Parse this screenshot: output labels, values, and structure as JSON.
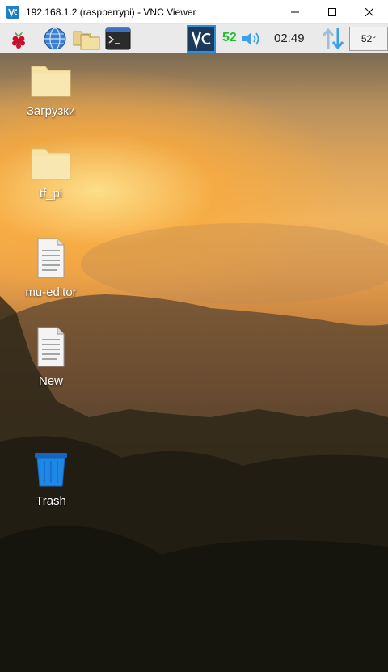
{
  "window": {
    "title": "192.168.1.2 (raspberrypi) - VNC Viewer",
    "app_icon": "vnc-viewer-icon"
  },
  "taskbar": {
    "launchers": [
      "raspberry-menu-icon",
      "web-browser-icon",
      "file-manager-icon",
      "terminal-icon"
    ],
    "cpu_usage": "52",
    "clock": "02:49",
    "temperature": "52°"
  },
  "desktop": {
    "icons": [
      {
        "label": "Загрузки",
        "icon": "folder-icon"
      },
      {
        "label": "tf_pi",
        "icon": "folder-icon"
      },
      {
        "label": "mu-editor",
        "icon": "text-file-icon"
      },
      {
        "label": "New",
        "icon": "text-file-icon"
      },
      {
        "label": "Trash",
        "icon": "trash-icon"
      }
    ]
  },
  "colors": {
    "vnc_blue": "#1d7fc4",
    "cpu_green": "#1fbf2f",
    "network_arrow": "#3aa0ea"
  }
}
